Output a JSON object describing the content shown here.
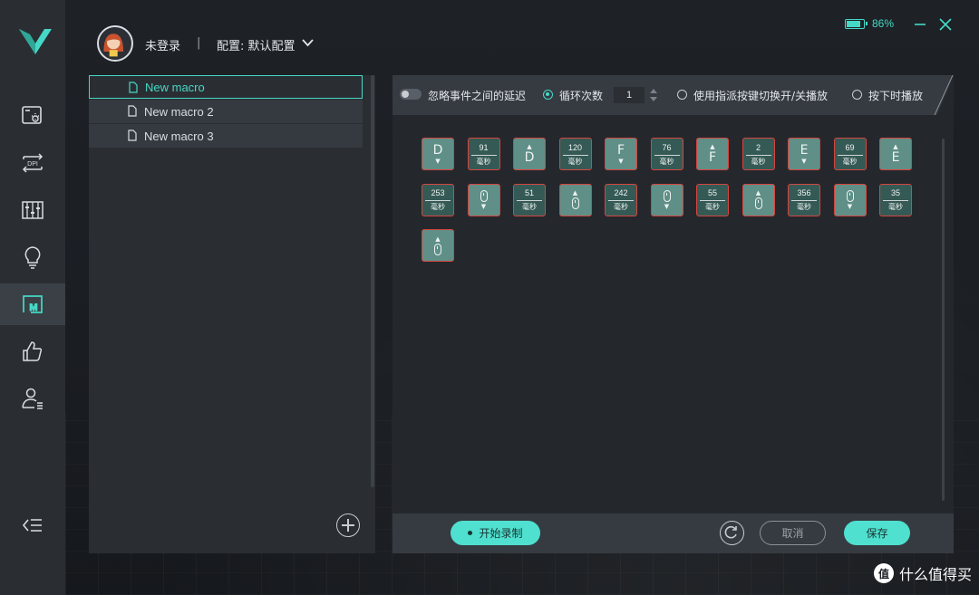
{
  "header": {
    "login_status": "未登录",
    "separator": "|",
    "config_label": "配置: 默认配置"
  },
  "window": {
    "battery_percent": "86%",
    "battery_level": 0.86
  },
  "sidebar": {
    "items": [
      {
        "icon": "mouse-settings-icon"
      },
      {
        "icon": "dpi-icon",
        "text": "DPI"
      },
      {
        "icon": "equalizer-icon"
      },
      {
        "icon": "lightbulb-icon"
      },
      {
        "icon": "macro-icon",
        "text": "M",
        "active": true
      },
      {
        "icon": "thumbs-up-icon"
      },
      {
        "icon": "user-profile-icon"
      },
      {
        "icon": "collapse-menu-icon"
      }
    ]
  },
  "macros": [
    {
      "label": "New macro",
      "selected": true
    },
    {
      "label": "New macro 2"
    },
    {
      "label": "New macro 3"
    }
  ],
  "options": {
    "ignore_delay_label": "忽略事件之间的延迟",
    "loop_count_label": "循环次数",
    "loop_count_value": "1",
    "toggle_label": "使用指派按键切换开/关播放",
    "hold_label": "按下时播放"
  },
  "events": [
    {
      "type": "key",
      "key": "D",
      "dir": "down"
    },
    {
      "type": "delay",
      "value": "91",
      "unit": "毫秒"
    },
    {
      "type": "key",
      "key": "D",
      "dir": "up"
    },
    {
      "type": "delay",
      "value": "120",
      "unit": "毫秒"
    },
    {
      "type": "key",
      "key": "F",
      "dir": "down"
    },
    {
      "type": "delay",
      "value": "76",
      "unit": "毫秒"
    },
    {
      "type": "key",
      "key": "F",
      "dir": "up"
    },
    {
      "type": "delay",
      "value": "2",
      "unit": "毫秒"
    },
    {
      "type": "key",
      "key": "E",
      "dir": "down"
    },
    {
      "type": "delay",
      "value": "69",
      "unit": "毫秒"
    },
    {
      "type": "key",
      "key": "E",
      "dir": "up"
    },
    {
      "type": "delay",
      "value": "253",
      "unit": "毫秒"
    },
    {
      "type": "mouse",
      "dir": "down"
    },
    {
      "type": "delay",
      "value": "51",
      "unit": "毫秒"
    },
    {
      "type": "mouse",
      "dir": "up"
    },
    {
      "type": "delay",
      "value": "242",
      "unit": "毫秒"
    },
    {
      "type": "mouse",
      "dir": "down"
    },
    {
      "type": "delay",
      "value": "55",
      "unit": "毫秒"
    },
    {
      "type": "mouse",
      "dir": "up"
    },
    {
      "type": "delay",
      "value": "356",
      "unit": "毫秒"
    },
    {
      "type": "mouse",
      "dir": "down"
    },
    {
      "type": "delay",
      "value": "35",
      "unit": "毫秒"
    },
    {
      "type": "mouse",
      "dir": "up"
    }
  ],
  "actions": {
    "record_label": "开始录制",
    "cancel_label": "取消",
    "save_label": "保存"
  },
  "watermark": {
    "icon_text": "值",
    "text": "什么值得买"
  },
  "colors": {
    "accent": "#46d8c6",
    "event_fill": "#5f8f87",
    "event_border": "#d6453f",
    "delay_fill": "#355a55"
  }
}
